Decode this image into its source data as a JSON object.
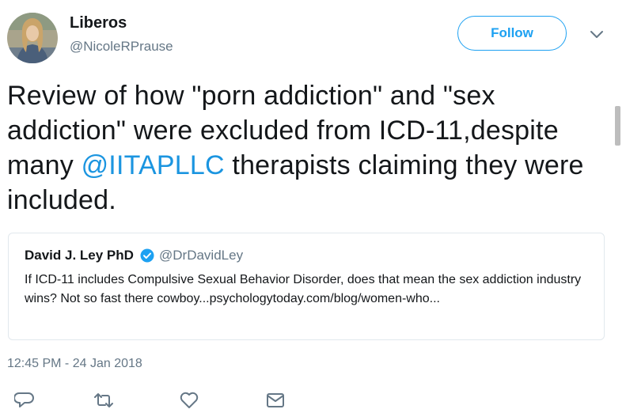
{
  "user": {
    "display_name": "Liberos",
    "handle": "@NicoleRPrause"
  },
  "header": {
    "follow_label": "Follow"
  },
  "tweet": {
    "text_part1": "Review of how \"porn addiction\" and \"sex addiction\" were excluded from ICD-11,despite many ",
    "mention": "@IITAPLLC",
    "text_part2": " therapists claiming they were included.",
    "timestamp": "12:45 PM - 24 Jan 2018"
  },
  "quoted": {
    "author": "David J. Ley PhD",
    "handle": "@DrDavidLey",
    "text": "If ICD-11 includes Compulsive Sexual Behavior Disorder, does that mean the sex addiction industry wins? Not so fast there cowboy...psychologytoday.com/blog/women-who..."
  },
  "actions": [
    {
      "icon": "reply-icon"
    },
    {
      "icon": "retweet-icon"
    },
    {
      "icon": "like-icon"
    },
    {
      "icon": "direct-message-icon"
    }
  ],
  "colors": {
    "accent": "#1da1f2",
    "mention": "#1b95e0",
    "secondary_text": "#657786",
    "primary_text": "#14171a",
    "border": "#e1e8ed"
  }
}
